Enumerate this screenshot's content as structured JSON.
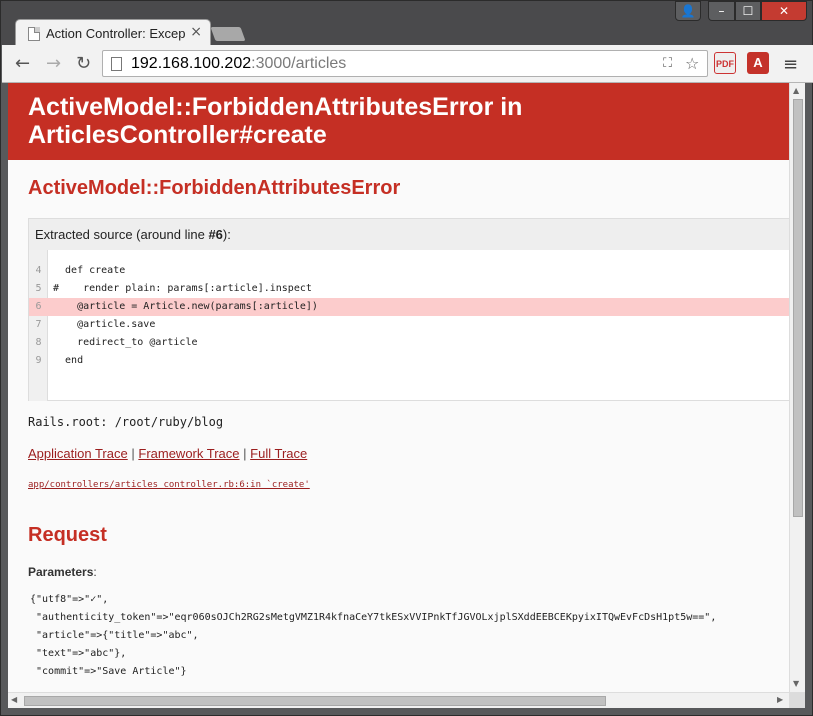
{
  "browser": {
    "tab_title": "Action Controller: Excep",
    "tab_close": "×",
    "url_host": "192.168.100.202",
    "url_port_path": ":3000/articles",
    "window_controls": {
      "user": "👤",
      "minimize": "–",
      "maximize": "☐",
      "close": "✕"
    },
    "nav": {
      "back": "←",
      "forward": "→",
      "reload": "↻"
    },
    "icons": [
      "page-icon",
      "translate-icon",
      "star-icon",
      "pdf-extension-icon",
      "acrobat-extension-icon",
      "menu-icon"
    ],
    "ext_pdf": "PDF",
    "ext_a": "A",
    "menu": "≡",
    "translate": "⛶",
    "star": "☆"
  },
  "error_page": {
    "header_line1": "ActiveModel::ForbiddenAttributesError in",
    "header_line2": "ArticlesController#create",
    "exception_name": "ActiveModel::ForbiddenAttributesError",
    "source": {
      "heading_prefix": "Extracted source (around line ",
      "heading_line": "#6",
      "heading_suffix": "):",
      "lines": [
        {
          "num": "4",
          "text": "  def create"
        },
        {
          "num": "5",
          "text": "#    render plain: params[:article].inspect"
        },
        {
          "num": "6",
          "text": "    @article = Article.new(params[:article])"
        },
        {
          "num": "7",
          "text": "    @article.save"
        },
        {
          "num": "8",
          "text": "    redirect_to @article"
        },
        {
          "num": "9",
          "text": "  end"
        }
      ]
    },
    "rails_root": "Rails.root: /root/ruby/blog",
    "traces": {
      "application": "Application Trace",
      "framework": "Framework Trace",
      "full": "Full Trace",
      "sep": "|"
    },
    "trace_line": "app/controllers/articles_controller.rb:6:in `create'",
    "request_title": "Request",
    "parameters_label": "Parameters",
    "parameters_colon": ":",
    "params_lines": [
      "{\"utf8\"=>\"✓\",",
      " \"authenticity_token\"=>\"eqr060sOJCh2RG2sMetgVMZ1R4kfnaCeY7tkESxVVIPnkTfJGVOLxjplSXddEEBCEKpyixITQwEvFcDsH1pt5w==\",",
      " \"article\"=>{\"title\"=>\"abc\",",
      " \"text\"=>\"abc\"},",
      " \"commit\"=>\"Save Article\"}"
    ]
  },
  "colors": {
    "rails_red": "#c52f24",
    "highlight": "#fccccc",
    "link": "#9b1e1e"
  }
}
